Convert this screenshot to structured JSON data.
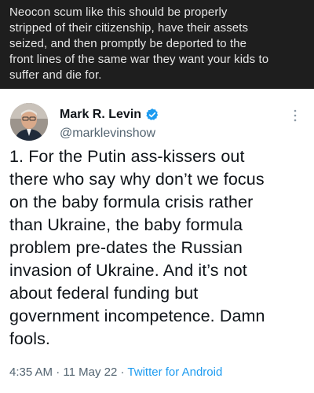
{
  "top_comment": {
    "lines": [
      "Neocon scum like this should be properly",
      "stripped of their citizenship, have their assets",
      "seized, and then promptly be deported to the",
      "front lines of the same war they want your kids to",
      "suffer and die for."
    ]
  },
  "tweet": {
    "author_name": "Mark R. Levin",
    "author_handle": "@marklevinshow",
    "verified": true,
    "text_lines": [
      "1. For the Putin ass-kissers out",
      "there who say why don’t we focus",
      "on the baby formula crisis rather",
      "than Ukraine, the baby formula",
      "problem pre-dates the Russian",
      "invasion of Ukraine. And it’s not",
      "about federal funding but",
      "government incompetence. Damn",
      "fools."
    ],
    "time": "4:35 AM",
    "separator": "·",
    "date": "11 May 22",
    "source": "Twitter for Android"
  },
  "icons": {
    "verified": "verified-badge-icon",
    "more": "more-vertical-icon"
  },
  "colors": {
    "top_background": "#1e1e1e",
    "top_text": "#e8e8e8",
    "verified_blue": "#1d9bf0",
    "link_blue": "#1d9bf0",
    "secondary_text": "#536471"
  }
}
